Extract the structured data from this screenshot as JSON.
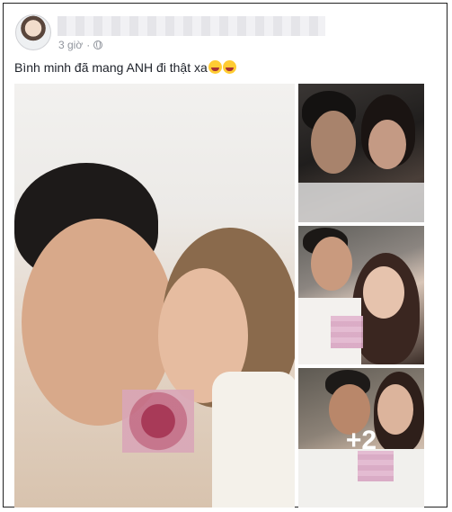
{
  "post": {
    "time": "3 giờ",
    "text": "Bình minh đã mang ANH đi thật xa",
    "emoji": [
      "grinning-squinting-face",
      "grinning-squinting-face"
    ]
  },
  "photos": {
    "more_label": "+2"
  }
}
